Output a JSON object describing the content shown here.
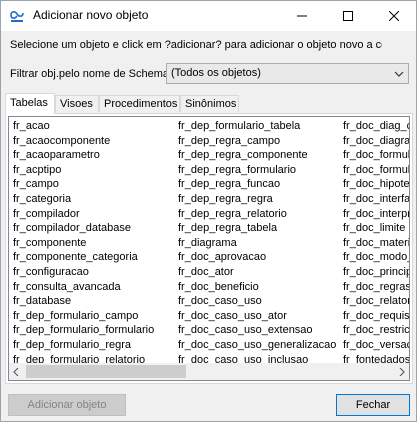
{
  "window": {
    "title": "Adicionar novo objeto",
    "icon": "dbdesigner-app-icon"
  },
  "instructions": "Selecione um objeto e click em  ?adicionar? para adicionar o objeto novo a co",
  "filter": {
    "label": "Filtrar obj.pelo nome de Schema",
    "value": "(Todos os objetos)"
  },
  "tabs": [
    {
      "label": "Tabelas",
      "active": true
    },
    {
      "label": "Visoes",
      "active": false
    },
    {
      "label": "Procedimentos",
      "active": false
    },
    {
      "label": "Sinônimos",
      "active": false
    }
  ],
  "list": {
    "columns": [
      [
        "fr_acao",
        "fr_acaocomponente",
        "fr_acaoparametro",
        "fr_acptipo",
        "fr_campo",
        "fr_categoria",
        "fr_compilador",
        "fr_compilador_database",
        "fr_componente",
        "fr_componente_categoria",
        "fr_configuracao",
        "fr_consulta_avancada",
        "fr_database",
        "fr_dep_formulario_campo",
        "fr_dep_formulario_formulario",
        "fr_dep_formulario_regra",
        "fr_dep_formulario_relatorio"
      ],
      [
        "fr_dep_formulario_tabela",
        "fr_dep_regra_campo",
        "fr_dep_regra_componente",
        "fr_dep_regra_formulario",
        "fr_dep_regra_funcao",
        "fr_dep_regra_regra",
        "fr_dep_regra_relatorio",
        "fr_dep_regra_tabela",
        "fr_diagrama",
        "fr_doc_aprovacao",
        "fr_doc_ator",
        "fr_doc_beneficio",
        "fr_doc_caso_uso",
        "fr_doc_caso_uso_ator",
        "fr_doc_caso_uso_extensao",
        "fr_doc_caso_uso_generalizacao",
        "fr_doc_caso_uso_inclusao"
      ],
      [
        "fr_doc_diag_c",
        "fr_doc_diagra",
        "fr_doc_formul",
        "fr_doc_formul",
        "fr_doc_hipotes",
        "fr_doc_interfa",
        "fr_doc_interpr",
        "fr_doc_limite",
        "fr_doc_materia",
        "fr_doc_modo_",
        "fr_doc_princip",
        "fr_doc_regras",
        "fr_doc_relator",
        "fr_doc_requisi",
        "fr_doc_restrica",
        "fr_doc_versac",
        "fr_fontedados"
      ]
    ]
  },
  "buttons": {
    "add": "Adicionar objeto",
    "close": "Fechar"
  },
  "colors": {
    "window_bg": "#f0f0f0",
    "focus_border": "#0078d7",
    "disabled_text": "#838383"
  }
}
